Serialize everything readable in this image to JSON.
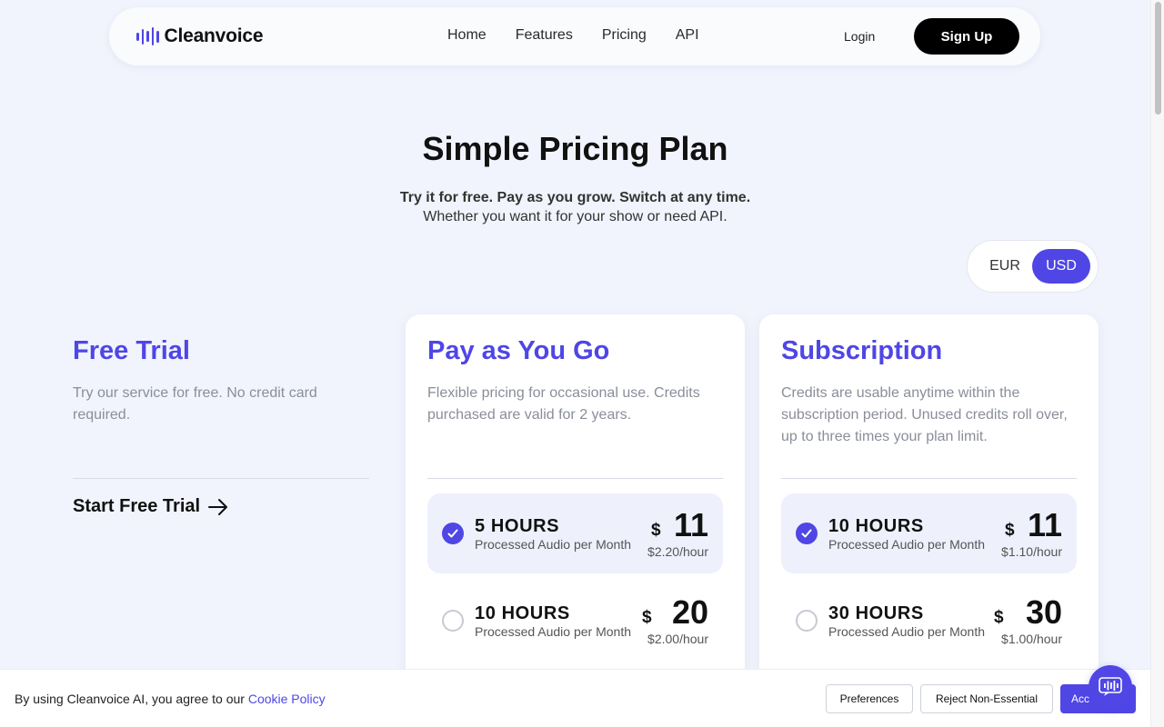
{
  "nav": {
    "logo": "Cleanvoice",
    "links": [
      "Home",
      "Features",
      "Pricing",
      "API"
    ],
    "login": "Login",
    "signup": "Sign Up"
  },
  "hero": {
    "title": "Simple Pricing Plan",
    "subtitle_bold": "Try it for free. Pay as you grow. Switch at any time.",
    "subtitle": "Whether you want it for your show or need API."
  },
  "currency": {
    "options": [
      "EUR",
      "USD"
    ],
    "selected": "USD",
    "accent": "#4f46e5"
  },
  "plans": {
    "free": {
      "title": "Free Trial",
      "desc": "Try our service for free. No credit card required.",
      "cta": "Start Free Trial"
    },
    "payg": {
      "title": "Pay as You Go",
      "desc": "Flexible pricing for occasional use. Credits purchased are valid for 2 years.",
      "options": [
        {
          "hours": "5 HOURS",
          "sub": "Processed Audio per Month",
          "currency": "$",
          "price": "11",
          "rate": "$2.20/hour",
          "selected": true
        },
        {
          "hours": "10 HOURS",
          "sub": "Processed Audio per Month",
          "currency": "$",
          "price": "20",
          "rate": "$2.00/hour",
          "selected": false
        }
      ]
    },
    "subscription": {
      "title": "Subscription",
      "desc": "Credits are usable anytime within the subscription period. Unused credits roll over, up to three times your plan limit.",
      "options": [
        {
          "hours": "10 HOURS",
          "sub": "Processed Audio per Month",
          "currency": "$",
          "price": "11",
          "rate": "$1.10/hour",
          "selected": true
        },
        {
          "hours": "30 HOURS",
          "sub": "Processed Audio per Month",
          "currency": "$",
          "price": "30",
          "rate": "$1.00/hour",
          "selected": false
        }
      ]
    }
  },
  "cookie": {
    "text": "By using Cleanvoice AI, you agree to our",
    "link": "Cookie Policy",
    "preferences": "Preferences",
    "reject": "Reject Non-Essential",
    "accept": "Acc"
  }
}
